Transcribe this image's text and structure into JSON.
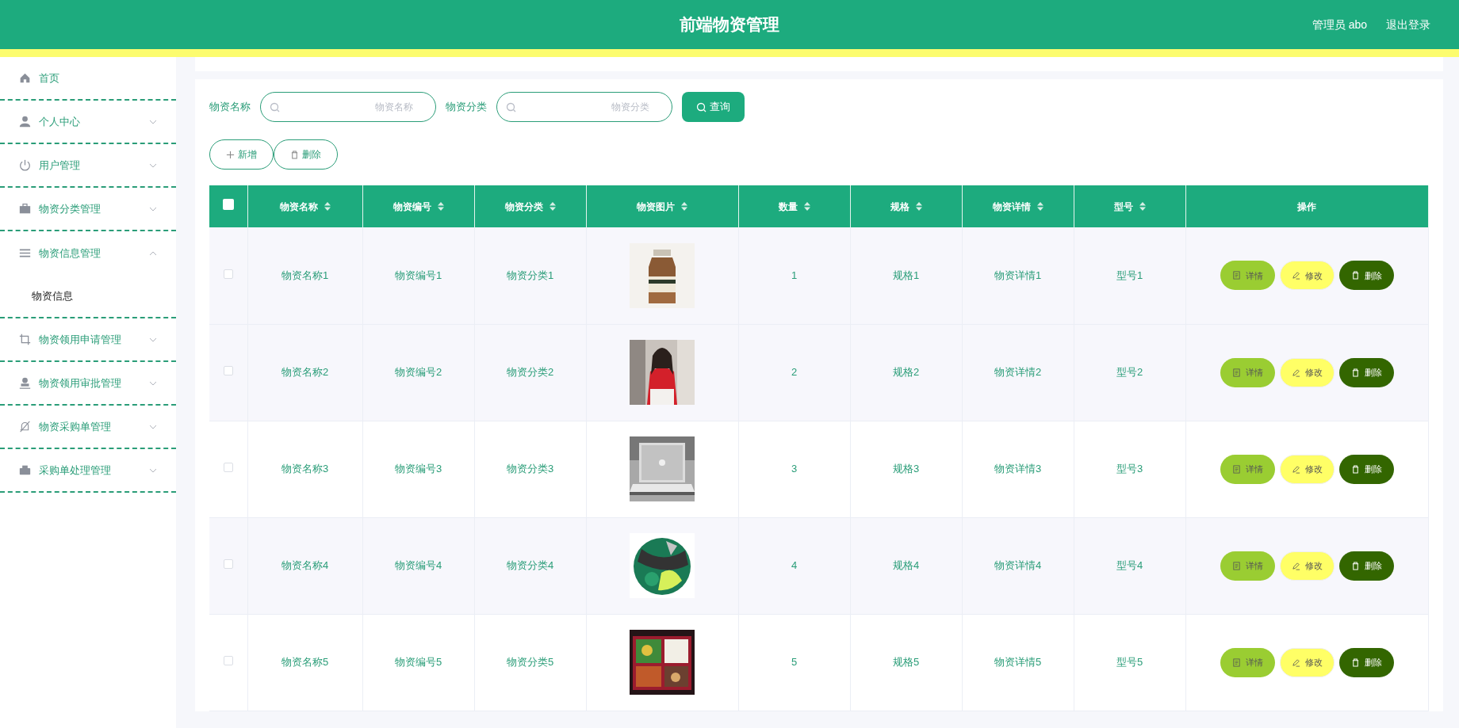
{
  "header": {
    "title": "前端物资管理",
    "user": "管理员 abo",
    "logout": "退出登录"
  },
  "sidebar": {
    "items": [
      {
        "label": "首页"
      },
      {
        "label": "个人中心",
        "expanded": false
      },
      {
        "label": "用户管理",
        "expanded": false
      },
      {
        "label": "物资分类管理",
        "expanded": false
      },
      {
        "label": "物资信息管理",
        "expanded": true,
        "children": [
          {
            "label": "物资信息"
          }
        ]
      },
      {
        "label": "物资领用申请管理",
        "expanded": false
      },
      {
        "label": "物资领用审批管理",
        "expanded": false
      },
      {
        "label": "物资采购单管理",
        "expanded": false
      },
      {
        "label": "采购单处理管理",
        "expanded": false
      }
    ]
  },
  "search": {
    "fields": [
      {
        "label": "物资名称",
        "placeholder": "物资名称"
      },
      {
        "label": "物资分类",
        "placeholder": "物资分类"
      }
    ],
    "button": "查询"
  },
  "actions": [
    {
      "label": "新增",
      "kind": "add"
    },
    {
      "label": "删除",
      "kind": "delete"
    }
  ],
  "table": {
    "select_all": {
      "checked": false
    },
    "columns": [
      {
        "label": "物资名称",
        "sortable": true
      },
      {
        "label": "物资编号",
        "sortable": true
      },
      {
        "label": "物资分类",
        "sortable": true
      },
      {
        "label": "物资图片",
        "sortable": true
      },
      {
        "label": "数量",
        "sortable": true
      },
      {
        "label": "规格",
        "sortable": true
      },
      {
        "label": "物资详情",
        "sortable": true
      },
      {
        "label": "型号",
        "sortable": true
      },
      {
        "label": "操作",
        "sortable": false
      }
    ],
    "rows": [
      {
        "selected": false,
        "cells": [
          "物资名称1",
          "物资编号1",
          "物资分类1",
          {
            "kind": "picture"
          },
          "1",
          "规格1",
          "物资详情1",
          "型号1"
        ],
        "actions": [
          {
            "label": "详情",
            "kind": "detail"
          },
          {
            "label": "修改",
            "kind": "edit"
          },
          {
            "label": "删除",
            "kind": "delete"
          }
        ]
      },
      {
        "selected": false,
        "cells": [
          "物资名称2",
          "物资编号2",
          "物资分类2",
          {
            "kind": "picture"
          },
          "2",
          "规格2",
          "物资详情2",
          "型号2"
        ],
        "actions": [
          {
            "label": "详情",
            "kind": "detail"
          },
          {
            "label": "修改",
            "kind": "edit"
          },
          {
            "label": "删除",
            "kind": "delete"
          }
        ]
      },
      {
        "selected": false,
        "cells": [
          "物资名称3",
          "物资编号3",
          "物资分类3",
          {
            "kind": "picture"
          },
          "3",
          "规格3",
          "物资详情3",
          "型号3"
        ],
        "actions": [
          {
            "label": "详情",
            "kind": "detail"
          },
          {
            "label": "修改",
            "kind": "edit"
          },
          {
            "label": "删除",
            "kind": "delete"
          }
        ]
      },
      {
        "selected": false,
        "cells": [
          "物资名称4",
          "物资编号4",
          "物资分类4",
          {
            "kind": "picture"
          },
          "4",
          "规格4",
          "物资详情4",
          "型号4"
        ],
        "actions": [
          {
            "label": "详情",
            "kind": "detail"
          },
          {
            "label": "修改",
            "kind": "edit"
          },
          {
            "label": "删除",
            "kind": "delete"
          }
        ]
      },
      {
        "selected": false,
        "cells": [
          "物资名称5",
          "物资编号5",
          "物资分类5",
          {
            "kind": "picture"
          },
          "5",
          "规格5",
          "物资详情5",
          "型号5"
        ],
        "actions": [
          {
            "label": "详情",
            "kind": "detail"
          },
          {
            "label": "修改",
            "kind": "edit"
          },
          {
            "label": "删除",
            "kind": "delete"
          }
        ]
      }
    ]
  }
}
